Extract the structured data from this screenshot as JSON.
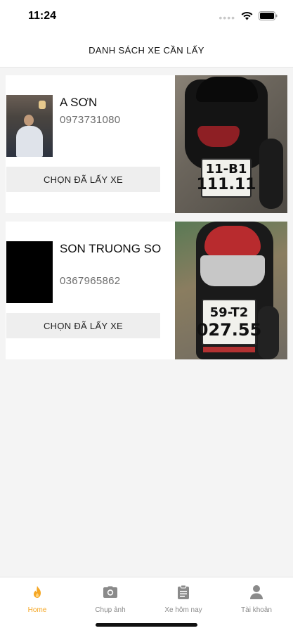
{
  "status_bar": {
    "time": "11:24"
  },
  "header": {
    "title": "DANH SÁCH XE CẦN LẤY"
  },
  "vehicles": [
    {
      "name": "A SƠN",
      "phone": "0973731080",
      "button_label": "CHỌN ĐÃ LẤY XE",
      "plate_top": "11-B1",
      "plate_bottom": "111.11"
    },
    {
      "name": "SON TRUONG SO",
      "phone": "0367965862",
      "button_label": "CHỌN ĐÃ LẤY XE",
      "plate_top": "59-T2",
      "plate_bottom": "027.55"
    }
  ],
  "tabs": [
    {
      "label": "Home",
      "icon": "fire-icon",
      "active": true
    },
    {
      "label": "Chụp ảnh",
      "icon": "camera-icon",
      "active": false
    },
    {
      "label": "Xe hôm nay",
      "icon": "clipboard-icon",
      "active": false
    },
    {
      "label": "Tài khoản",
      "icon": "person-icon",
      "active": false
    }
  ],
  "colors": {
    "accent": "#f5a623",
    "inactive_tab": "#8a8a8a",
    "background": "#f4f4f4",
    "button_bg": "#eeeeee"
  }
}
